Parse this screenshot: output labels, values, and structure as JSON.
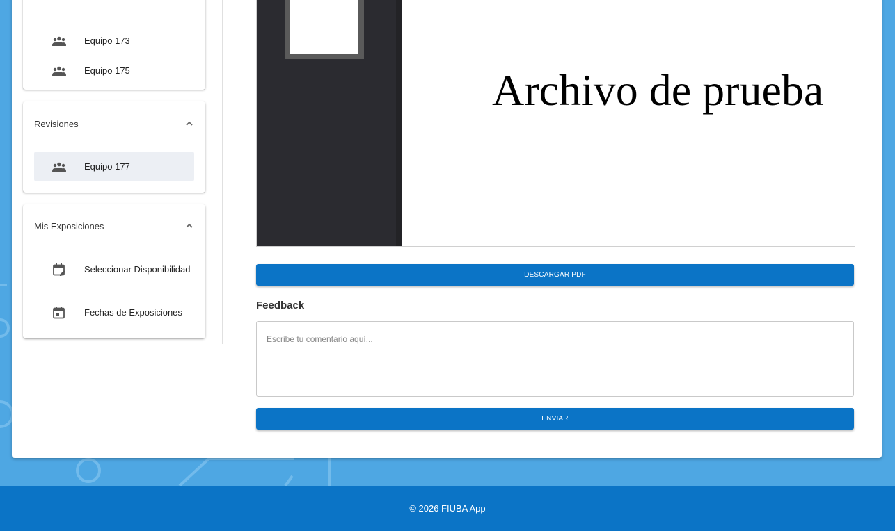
{
  "sidebar": {
    "equipos": [
      {
        "label": "Equipo 173",
        "icon": "group-icon"
      },
      {
        "label": "Equipo 175",
        "icon": "group-icon"
      }
    ],
    "revisiones": {
      "title": "Revisiones",
      "items": [
        {
          "label": "Equipo 177",
          "icon": "group-icon",
          "active": true
        }
      ]
    },
    "exposiciones": {
      "title": "Mis Exposiciones",
      "items": [
        {
          "label": "Seleccionar Disponibilidad",
          "icon": "calendar-edit-icon"
        },
        {
          "label": "Fechas de Exposiciones",
          "icon": "calendar-icon"
        }
      ]
    }
  },
  "viewer": {
    "document_title": "Archivo de prueba"
  },
  "actions": {
    "download_label": "DESCARGAR PDF",
    "send_label": "ENVIAR"
  },
  "feedback": {
    "label": "Feedback",
    "placeholder": "Escribe tu comentario aquí...",
    "value": ""
  },
  "footer": {
    "text": "© 2026 FIUBA App"
  },
  "colors": {
    "primary": "#0b74c6",
    "background": "#4ea7e3",
    "active_item": "#eceff4"
  }
}
